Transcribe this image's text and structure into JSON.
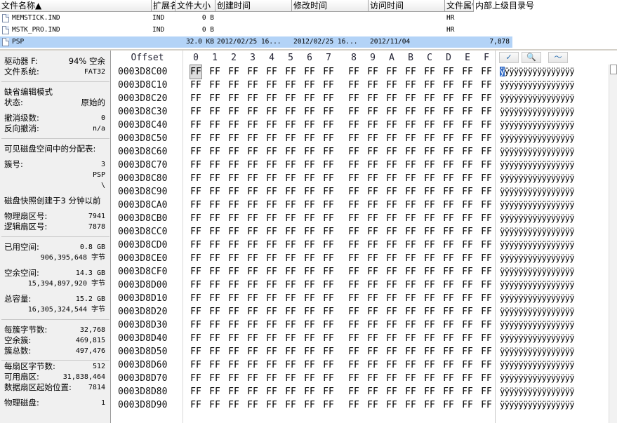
{
  "file_list": {
    "columns": [
      "文件名称▲",
      "扩展名",
      "文件大小",
      "创建时间",
      "修改时间",
      "访问时间",
      "文件属性",
      "内部上级目录号"
    ],
    "rows": [
      {
        "name": "MEMSTICK.IND",
        "ext": "IND",
        "size": "0 B",
        "created": "",
        "modified": "",
        "accessed": "",
        "attr": "HR",
        "parent": "",
        "selected": false
      },
      {
        "name": "MSTK_PRO.IND",
        "ext": "IND",
        "size": "0 B",
        "created": "",
        "modified": "",
        "accessed": "",
        "attr": "HR",
        "parent": "",
        "selected": false
      },
      {
        "name": "PSP",
        "ext": "",
        "size": "32.0 KB",
        "created": "2012/02/25  16...",
        "modified": "2012/02/25  16...",
        "accessed": "2012/11/04",
        "attr": "",
        "parent": "7,878",
        "selected": true
      }
    ]
  },
  "info_panel": {
    "drive_label": "驱动器 F:",
    "drive_value": "94% 空余",
    "fs_label": "文件系统:",
    "fs_value": "FAT32",
    "edit_mode_title": "缺省编辑模式",
    "state_label": "状态:",
    "state_value": "原始的",
    "undo_label": "撤消级数:",
    "undo_value": "0",
    "redo_label": "反向撤消:",
    "redo_value": "n/a",
    "alloc_title": "可见磁盘空间中的分配表:",
    "cluster_label": "簇号:",
    "cluster_value": "3",
    "path1": "PSP",
    "path2": "\\",
    "snapshot_text": "磁盘快照创建于3 分钟以前",
    "phys_sector_label": "物理扇区号:",
    "phys_sector_value": "7941",
    "logic_sector_label": "逻辑扇区号:",
    "logic_sector_value": "7878",
    "used_label": "已用空间:",
    "used_gb": "0.8 GB",
    "used_bytes": "906,395,648 字节",
    "free_label": "空余空间:",
    "free_gb": "14.3 GB",
    "free_bytes": "15,394,897,920 字节",
    "total_label": "总容量:",
    "total_gb": "15.2 GB",
    "total_bytes": "16,305,324,544 字节",
    "bpc_label": "每簇字节数:",
    "bpc_value": "32,768",
    "free_clusters_label": "空余簇:",
    "free_clusters_value": "469,815",
    "total_clusters_label": "簇总数:",
    "total_clusters_value": "497,476",
    "bps_label": "每扇区字节数:",
    "bps_value": "512",
    "avail_sectors_label": "可用扇区:",
    "avail_sectors_value": "31,838,464",
    "data_start_label": "数据扇区起始位置:",
    "data_start_value": "7814",
    "phys_disk_label": "物理磁盘:",
    "phys_disk_value": "1"
  },
  "hex_view": {
    "offset_label": "Offset",
    "columns": [
      "0",
      "1",
      "2",
      "3",
      "4",
      "5",
      "6",
      "7",
      "8",
      "9",
      "A",
      "B",
      "C",
      "D",
      "E",
      "F"
    ],
    "byte_value": "FF",
    "text_line": "ÿÿÿÿÿÿÿÿÿÿÿÿÿÿÿÿ",
    "cursor_char": "ÿ",
    "rest_chars": "ÿÿÿÿÿÿÿÿÿÿÿÿÿÿÿ",
    "offsets": [
      "0003D8C00",
      "0003D8C10",
      "0003D8C20",
      "0003D8C30",
      "0003D8C40",
      "0003D8C50",
      "0003D8C60",
      "0003D8C70",
      "0003D8C80",
      "0003D8C90",
      "0003D8CA0",
      "0003D8CB0",
      "0003D8CC0",
      "0003D8CD0",
      "0003D8CE0",
      "0003D8CF0",
      "0003D8D00",
      "0003D8D10",
      "0003D8D20",
      "0003D8D30",
      "0003D8D40",
      "0003D8D50",
      "0003D8D60",
      "0003D8D70",
      "0003D8D80",
      "0003D8D90"
    ]
  },
  "toolbar": {
    "icons": [
      "checkmark-icon",
      "find-icon",
      "wave-icon"
    ],
    "checkmark_glyph": "✓",
    "find_glyph": "🔍",
    "wave_glyph": "〜"
  }
}
